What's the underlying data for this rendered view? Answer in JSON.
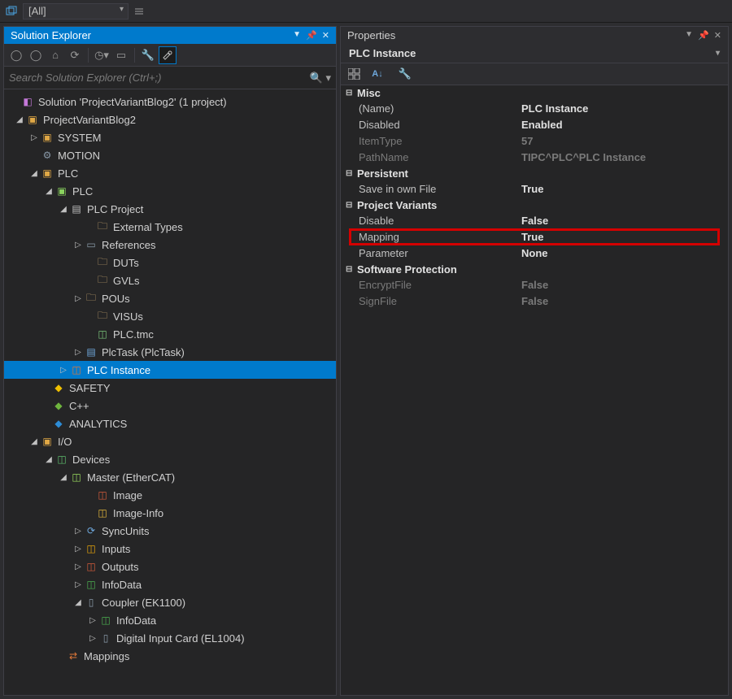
{
  "top": {
    "combo": "[All]"
  },
  "explorer": {
    "title": "Solution Explorer",
    "search_placeholder": "Search Solution Explorer (Ctrl+;)",
    "tree": {
      "solution": "Solution 'ProjectVariantBlog2' (1 project)",
      "project": "ProjectVariantBlog2",
      "system": "SYSTEM",
      "motion": "MOTION",
      "plc": "PLC",
      "plc_sub": "PLC",
      "plc_project": "PLC Project",
      "external_types": "External Types",
      "references": "References",
      "duts": "DUTs",
      "gvls": "GVLs",
      "pous": "POUs",
      "visus": "VISUs",
      "plctmc": "PLC.tmc",
      "plctask": "PlcTask (PlcTask)",
      "plc_instance": "PLC Instance",
      "safety": "SAFETY",
      "cpp": "C++",
      "analytics": "ANALYTICS",
      "io": "I/O",
      "devices": "Devices",
      "master": "Master (EtherCAT)",
      "image": "Image",
      "image_info": "Image-Info",
      "syncunits": "SyncUnits",
      "inputs": "Inputs",
      "outputs": "Outputs",
      "infodata": "InfoData",
      "coupler": "Coupler (EK1100)",
      "infodata2": "InfoData",
      "digital_input": "Digital Input Card (EL1004)",
      "mappings": "Mappings"
    }
  },
  "properties": {
    "title": "Properties",
    "object": "PLC Instance",
    "categories": [
      {
        "name": "Misc",
        "rows": [
          {
            "name": "(Name)",
            "value": "PLC Instance",
            "dim": false
          },
          {
            "name": "Disabled",
            "value": "Enabled",
            "dim": false
          },
          {
            "name": "ItemType",
            "value": "57",
            "dim": true
          },
          {
            "name": "PathName",
            "value": "TIPC^PLC^PLC Instance",
            "dim": true
          }
        ]
      },
      {
        "name": "Persistent",
        "rows": [
          {
            "name": "Save in own File",
            "value": "True",
            "dim": false
          }
        ]
      },
      {
        "name": "Project Variants",
        "rows": [
          {
            "name": "Disable",
            "value": "False",
            "dim": false
          },
          {
            "name": "Mapping",
            "value": "True",
            "dim": false,
            "highlight": true
          },
          {
            "name": "Parameter",
            "value": "None",
            "dim": false
          }
        ]
      },
      {
        "name": "Software Protection",
        "rows": [
          {
            "name": "EncryptFile",
            "value": "False",
            "dim": true
          },
          {
            "name": "SignFile",
            "value": "False",
            "dim": true
          }
        ]
      }
    ]
  }
}
